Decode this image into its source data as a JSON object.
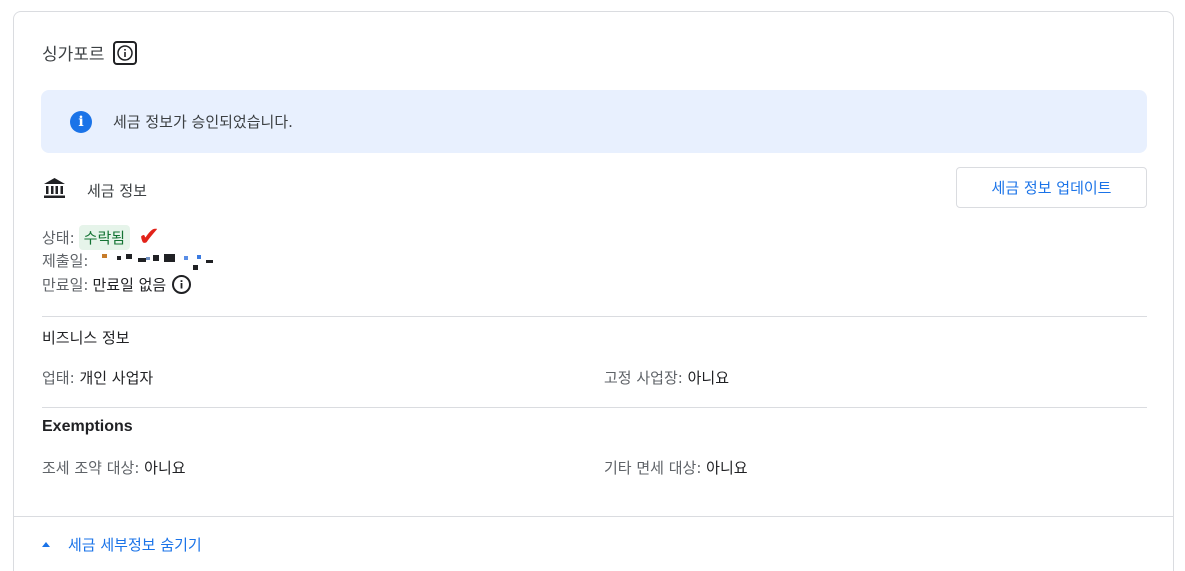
{
  "region": {
    "name": "싱가포르",
    "info_icon": "info-icon"
  },
  "banner": {
    "icon": "info-circle-icon",
    "text": "세금 정보가 승인되었습니다."
  },
  "tax_info": {
    "icon": "bank-icon",
    "title": "세금 정보",
    "update_button": "세금 정보 업데이트",
    "status_label": "상태:",
    "status_value": "수락됨",
    "submitted_label": "제출일:",
    "expiry_label": "만료일:",
    "expiry_value": "만료일 없음"
  },
  "business": {
    "title": "비즈니스 정보",
    "type_label": "업태:",
    "type_value": "개인 사업자",
    "fixed_label": "고정 사업장:",
    "fixed_value": "아니요"
  },
  "exemptions": {
    "title": "Exemptions",
    "treaty_label": "조세 조약 대상:",
    "treaty_value": "아니요",
    "other_label": "기타 면세 대상:",
    "other_value": "아니요"
  },
  "footer": {
    "hide_link": "세금 세부정보 숨기기"
  },
  "colors": {
    "accent": "#1a73e8",
    "banner_bg": "#e8f0fe",
    "badge_bg": "#e6f4ea",
    "badge_text": "#137333",
    "check": "#e2231a"
  }
}
